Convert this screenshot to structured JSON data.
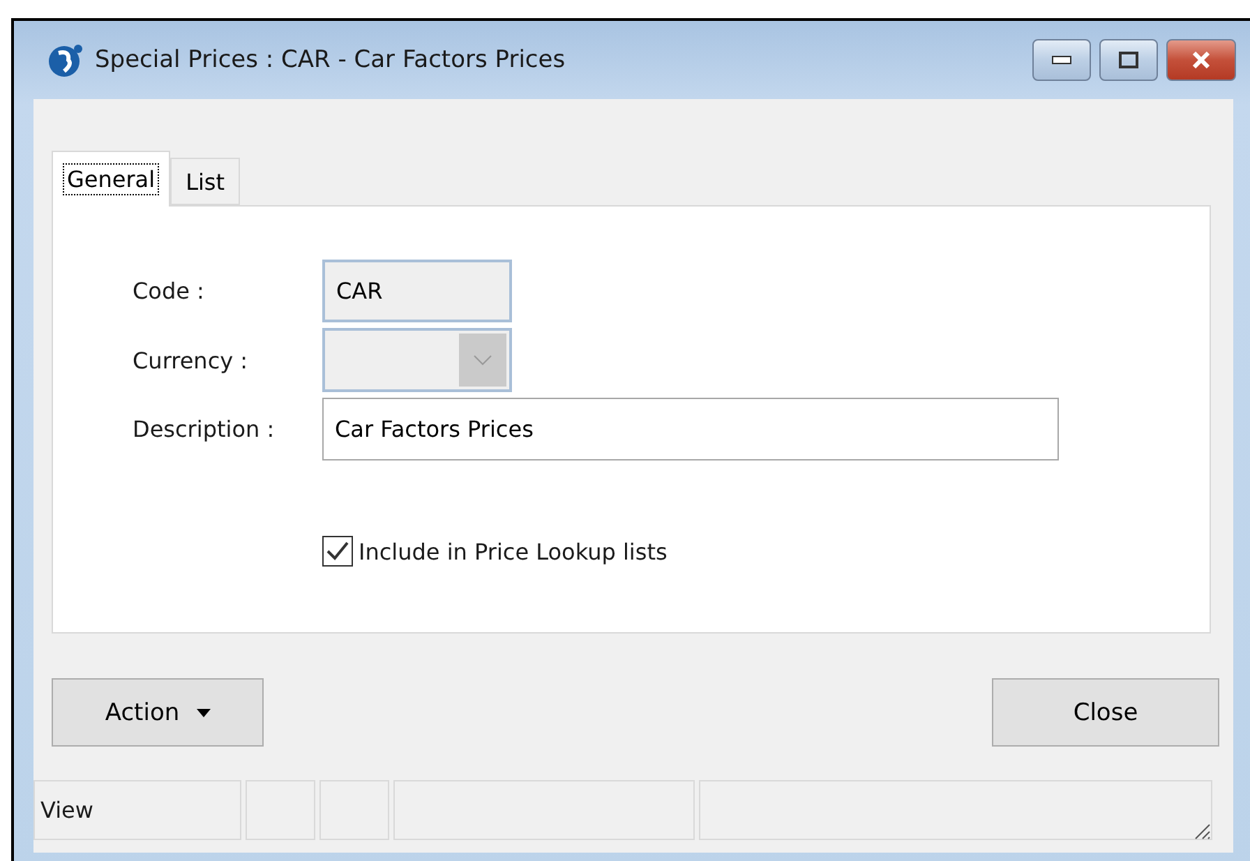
{
  "window": {
    "title": "Special Prices : CAR - Car Factors Prices"
  },
  "tabs": [
    {
      "label": "General",
      "selected": true
    },
    {
      "label": "List",
      "selected": false
    }
  ],
  "form": {
    "code": {
      "label": "Code :",
      "value": "CAR",
      "disabled": true
    },
    "currency": {
      "label": "Currency :",
      "disabled": true
    },
    "description": {
      "label": "Description :",
      "value": "Car Factors Prices",
      "disabled": false
    },
    "include_in_lookup": {
      "label": "Include in Price Lookup lists",
      "checked": true
    }
  },
  "buttons": [
    {
      "label": "Action",
      "kind": "dropdown"
    },
    {
      "label": "Close",
      "kind": "plain"
    }
  ],
  "status_bar": [
    "View"
  ]
}
